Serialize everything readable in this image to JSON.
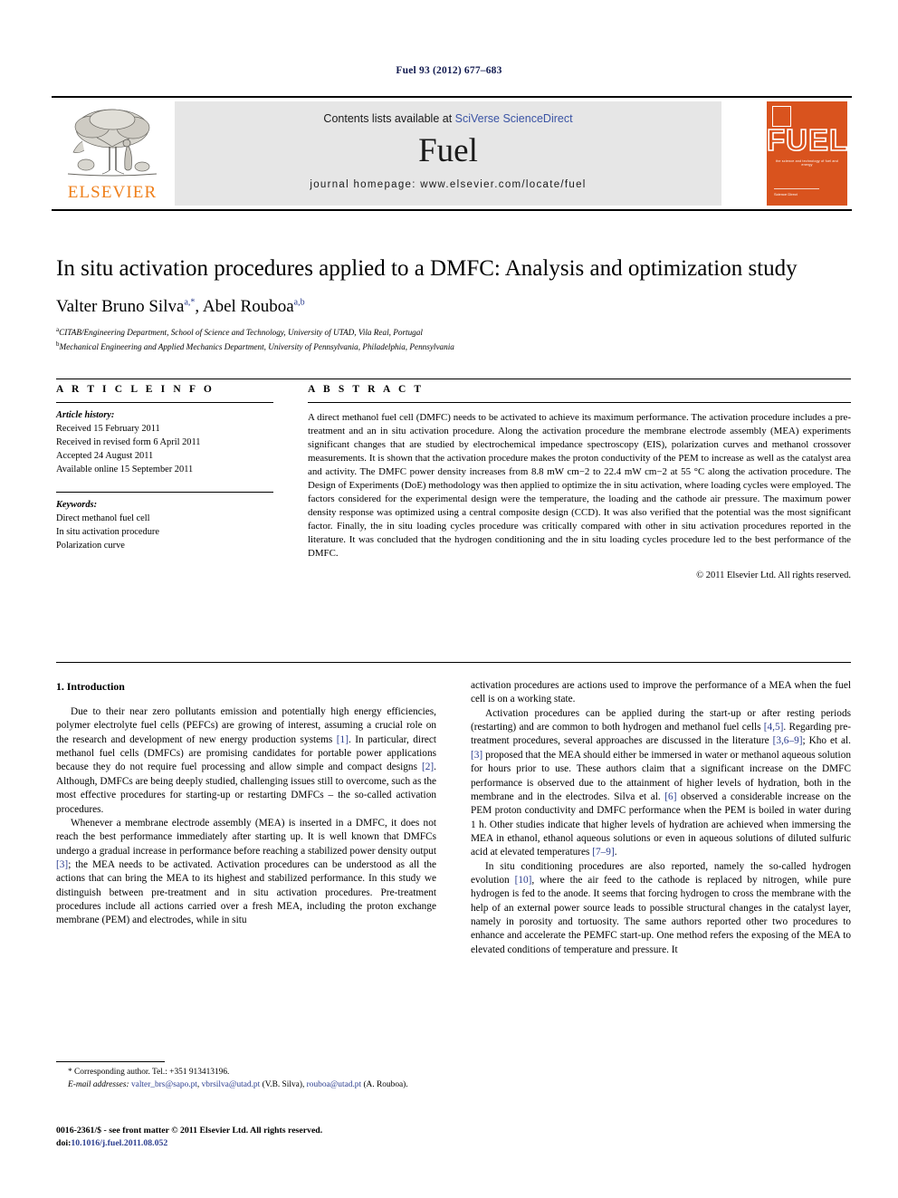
{
  "running_head": "Fuel 93 (2012) 677–683",
  "masthead": {
    "contents_prefix": "Contents lists available at ",
    "sciencedirect": "SciVerse ScienceDirect",
    "journal_name": "Fuel",
    "homepage": "journal homepage: www.elsevier.com/locate/fuel",
    "publisher_wordmark": "ELSEVIER",
    "cover": {
      "title": "FUEL",
      "tagline": "the science and technology of fuel and energy",
      "footer": "Science Direct"
    },
    "colors": {
      "link_blue": "#3a53a4",
      "elsevier_orange": "#ef7f1a",
      "cover_orange": "#d9531e",
      "band_grey": "#e6e6e6"
    }
  },
  "title": "In situ activation procedures applied to a DMFC: Analysis and optimization study",
  "authors": {
    "author_1": "Valter Bruno Silva",
    "author_1_sup": "a,*",
    "separator": ", ",
    "author_2": "Abel Rouboa",
    "author_2_sup": "a,b"
  },
  "affiliations": [
    {
      "mark": "a",
      "text": "CITAB/Engineering Department, School of Science and Technology, University of UTAD, Vila Real, Portugal"
    },
    {
      "mark": "b",
      "text": "Mechanical Engineering and Applied Mechanics Department, University of Pennsylvania, Philadelphia, Pennsylvania"
    }
  ],
  "article_info": {
    "heading": "A R T I C L E  I N F O",
    "history_label": "Article history:",
    "history": [
      "Received 15 February 2011",
      "Received in revised form 6 April 2011",
      "Accepted 24 August 2011",
      "Available online 15  September 2011"
    ],
    "keywords_label": "Keywords:",
    "keywords": [
      "Direct methanol fuel cell",
      "In situ activation procedure",
      "Polarization curve"
    ]
  },
  "abstract": {
    "heading": "A B S T R A C T",
    "text": "A direct methanol fuel cell (DMFC) needs to be activated to achieve its maximum performance. The activation procedure includes a pre-treatment and an in situ activation procedure. Along the activation procedure the membrane electrode assembly (MEA) experiments significant changes that are studied by electrochemical impedance spectroscopy (EIS), polarization curves and methanol crossover measurements. It is shown that the activation procedure makes the proton conductivity of the PEM to increase as well as the catalyst area and activity. The DMFC power density increases from 8.8 mW cm−2 to 22.4 mW cm−2 at 55 °C along the activation procedure. The Design of Experiments (DoE) methodology was then applied to optimize the in situ activation, where loading cycles were employed. The factors considered for the experimental design were the temperature, the loading and the cathode air pressure. The maximum power density response was optimized using a central composite design (CCD). It was also verified that the potential was the most significant factor. Finally, the in situ loading cycles procedure was critically compared with other in situ activation procedures reported in the literature. It was concluded that the hydrogen conditioning and the in situ loading cycles procedure led to the best performance of the DMFC.",
    "copyright": "© 2011 Elsevier Ltd. All rights reserved."
  },
  "body": {
    "section_heading": "1. Introduction",
    "left_paragraphs": [
      "Due to their near zero pollutants emission and potentially high energy efficiencies, polymer electrolyte fuel cells (PEFCs) are growing of interest, assuming a crucial role on the research and development of new energy production systems [1]. In particular, direct methanol fuel cells (DMFCs) are promising candidates for portable power applications because they do not require fuel processing and allow simple and compact designs [2]. Although, DMFCs are being deeply studied, challenging issues still to overcome, such as the most effective procedures for starting-up or restarting DMFCs – the so-called activation procedures.",
      "Whenever a membrane electrode assembly (MEA) is inserted in a DMFC, it does not reach the best performance immediately after starting up. It is well known that DMFCs undergo a gradual increase in performance before reaching a stabilized power density output [3]; the MEA needs to be activated. Activation procedures can be understood as all the actions that can bring the MEA to its highest and stabilized performance. In this study we distinguish between pre-treatment and in situ activation procedures. Pre-treatment procedures include all actions carried over a fresh MEA, including the proton exchange membrane (PEM) and electrodes, while in situ"
    ],
    "right_paragraphs": [
      "activation procedures are actions used to improve the performance of a MEA when the fuel cell is on a working state.",
      "Activation procedures can be applied during the start-up or after resting periods (restarting) and are common to both hydrogen and methanol fuel cells [4,5]. Regarding pre-treatment procedures, several approaches are discussed in the literature [3,6–9]; Kho et al. [3] proposed that the MEA should either be immersed in water or methanol aqueous solution for hours prior to use. These authors claim that a significant increase on the DMFC performance is observed due to the attainment of higher levels of hydration, both in the membrane and in the electrodes. Silva et al. [6] observed a considerable increase on the PEM proton conductivity and DMFC performance when the PEM is boiled in water during 1 h. Other studies indicate that higher levels of hydration are achieved when immersing the MEA in ethanol, ethanol aqueous solutions or even in aqueous solutions of diluted sulfuric acid at elevated temperatures [7–9].",
      "In situ conditioning procedures are also reported, namely the so-called hydrogen evolution [10], where the air feed to the cathode is replaced by nitrogen, while pure hydrogen is fed to the anode. It seems that forcing hydrogen to cross the membrane with the help of an external power source leads to possible structural changes in the catalyst layer, namely in porosity and tortuosity. The same authors reported other two procedures to enhance and accelerate the PEMFC start-up. One method refers the exposing of the MEA to elevated conditions of temperature and pressure. It"
    ]
  },
  "footnotes": {
    "corresponding": "* Corresponding author. Tel.: +351 913413196.",
    "email_label": "E-mail addresses:",
    "email_1": "valter_brs@sapo.pt",
    "email_2": "vbrsilva@utad.pt",
    "email_1_owner": " (V.B. Silva), ",
    "email_3": "rouboa@utad.pt",
    "email_3_owner": " (A. Rouboa)."
  },
  "imprint": {
    "line_1": "0016-2361/$ - see front matter © 2011 Elsevier Ltd. All rights reserved.",
    "doi_label": "doi:",
    "doi_value": "10.1016/j.fuel.2011.08.052"
  }
}
